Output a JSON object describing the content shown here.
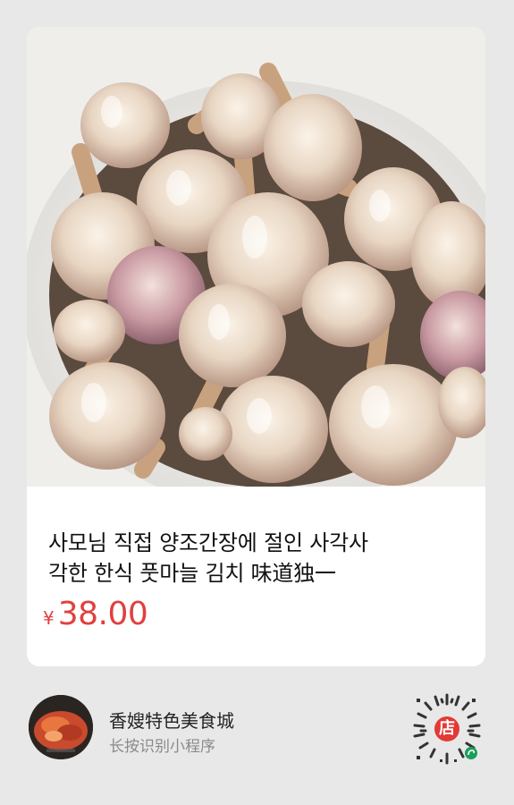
{
  "product": {
    "title_line1": "사모님 직접 양조간장에 절인 사각사",
    "title_line2": "각한 한식 풋마늘 김치  味道独一",
    "currency": "¥",
    "price": "38.00"
  },
  "shop": {
    "name": "香嫂特色美食城",
    "hint": "长按识别小程序",
    "qr_badge": "店"
  },
  "colors": {
    "background": "#e8e8e8",
    "card": "#ffffff",
    "price": "#e0403e",
    "qr_badge": "#e23a35",
    "qr_corner": "#19a05a"
  },
  "icons": {
    "avatar": "shop-avatar-food-photo",
    "qr": "mini-program-code-icon"
  }
}
